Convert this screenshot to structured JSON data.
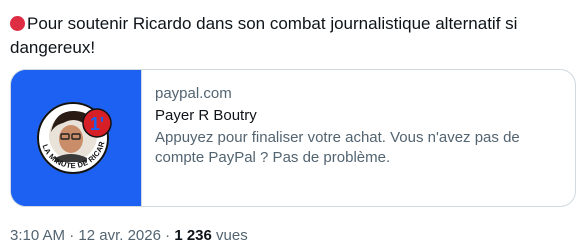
{
  "tweet": {
    "text": "Pour soutenir Ricardo dans son combat journalistique alternatif si dangereux!",
    "emoji_icon": "red-circle-icon"
  },
  "card": {
    "domain": "paypal.com",
    "title": "Payer R Boutry",
    "description": "Appuyez pour finaliser votre achat. Vous n'avez pas de compte PayPal ? Pas de problème.",
    "logo_text": "LA MINUTE DE RICARDO.COM",
    "logo_badge": "1'",
    "logo_bg_color": "#1d61f2",
    "badge_color": "#d61f26"
  },
  "meta": {
    "time": "3:10 AM",
    "separator": "·",
    "date": "12 avr. 2026",
    "views_count": "1 236",
    "views_label": "vues"
  }
}
